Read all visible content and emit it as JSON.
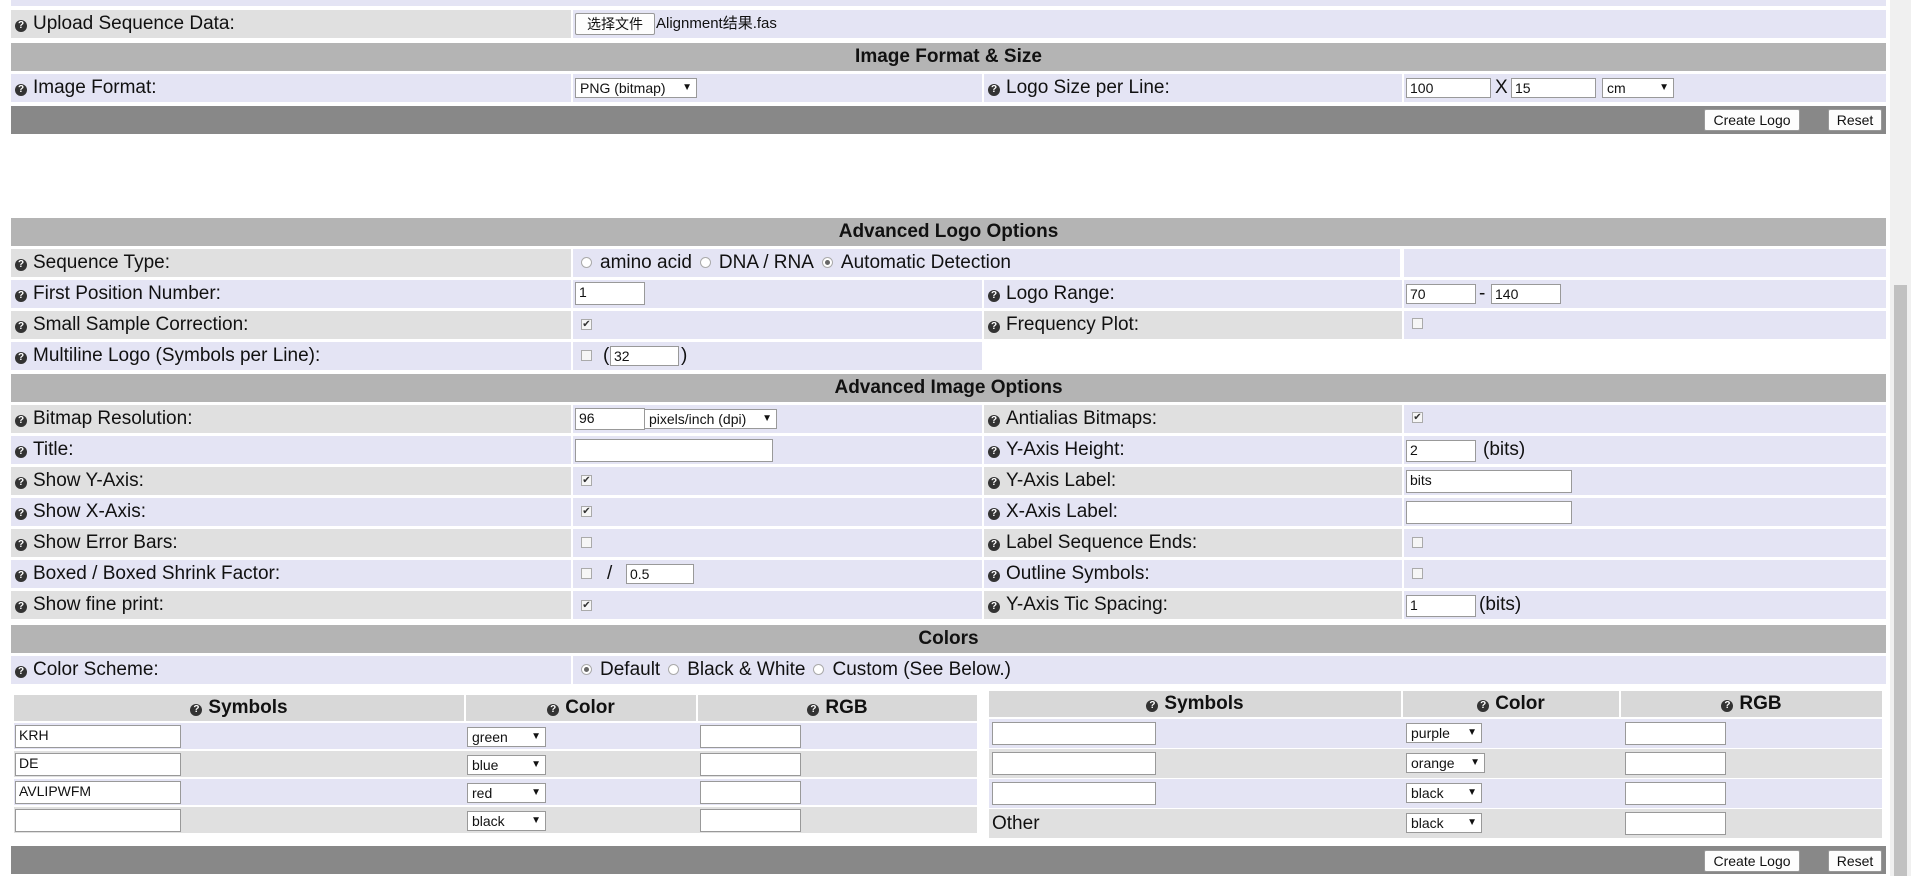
{
  "upload": {
    "label": "Upload Sequence Data:",
    "button": "选择文件",
    "filename": "Alignment结果.fas"
  },
  "image_format_section": {
    "header": "Image Format & Size",
    "format_label": "Image Format:",
    "format_value": "PNG (bitmap)",
    "size_label": "Logo Size per Line:",
    "width": "100",
    "x": "X",
    "height": "15",
    "unit": "cm"
  },
  "buttons": {
    "create": "Create Logo",
    "reset": "Reset"
  },
  "advanced_logo": {
    "header": "Advanced Logo Options",
    "seq_type_label": "Sequence Type:",
    "seq_types": [
      "amino acid",
      "DNA / RNA",
      "Automatic Detection"
    ],
    "first_pos_label": "First Position Number:",
    "first_pos_value": "1",
    "range_label": "Logo Range:",
    "range_from": "70",
    "range_dash": "-",
    "range_to": "140",
    "small_sample_label": "Small Sample Correction:",
    "freq_label": "Frequency Plot:",
    "multiline_label": "Multiline Logo (Symbols per Line):",
    "multiline_value": "32",
    "paren_open": "(",
    "paren_close": ")"
  },
  "advanced_image": {
    "header": "Advanced Image Options",
    "resolution_label": "Bitmap Resolution:",
    "resolution_value": "96",
    "resolution_unit": "pixels/inch (dpi)",
    "antialias_label": "Antialias Bitmaps:",
    "title_label": "Title:",
    "yheight_label": "Y-Axis Height:",
    "yheight_value": "2",
    "bits": "(bits)",
    "show_y_label": "Show Y-Axis:",
    "ylabel_label": "Y-Axis Label:",
    "ylabel_value": "bits",
    "show_x_label": "Show X-Axis:",
    "xlabel_label": "X-Axis Label:",
    "error_bars_label": "Show Error Bars:",
    "label_ends_label": "Label Sequence Ends:",
    "boxed_label": "Boxed / Boxed Shrink Factor:",
    "shrink_value": "0.5",
    "slash": "/",
    "outline_label": "Outline Symbols:",
    "fine_print_label": "Show fine print:",
    "tic_label": "Y-Axis Tic Spacing:",
    "tic_value": "1"
  },
  "colors": {
    "header": "Colors",
    "scheme_label": "Color Scheme:",
    "schemes": [
      "Default",
      "Black & White",
      "Custom (See Below.)"
    ],
    "col_symbols": "Symbols",
    "col_color": "Color",
    "col_rgb": "RGB",
    "left_rows": [
      {
        "symbols": "KRH",
        "color": "green"
      },
      {
        "symbols": "DE",
        "color": "blue"
      },
      {
        "symbols": "AVLIPWFM",
        "color": "red"
      },
      {
        "symbols": "",
        "color": "black"
      }
    ],
    "right_rows": [
      {
        "symbols": "",
        "color": "purple"
      },
      {
        "symbols": "",
        "color": "orange"
      },
      {
        "symbols": "",
        "color": "black"
      }
    ],
    "other_label": "Other",
    "other_color": "black"
  }
}
